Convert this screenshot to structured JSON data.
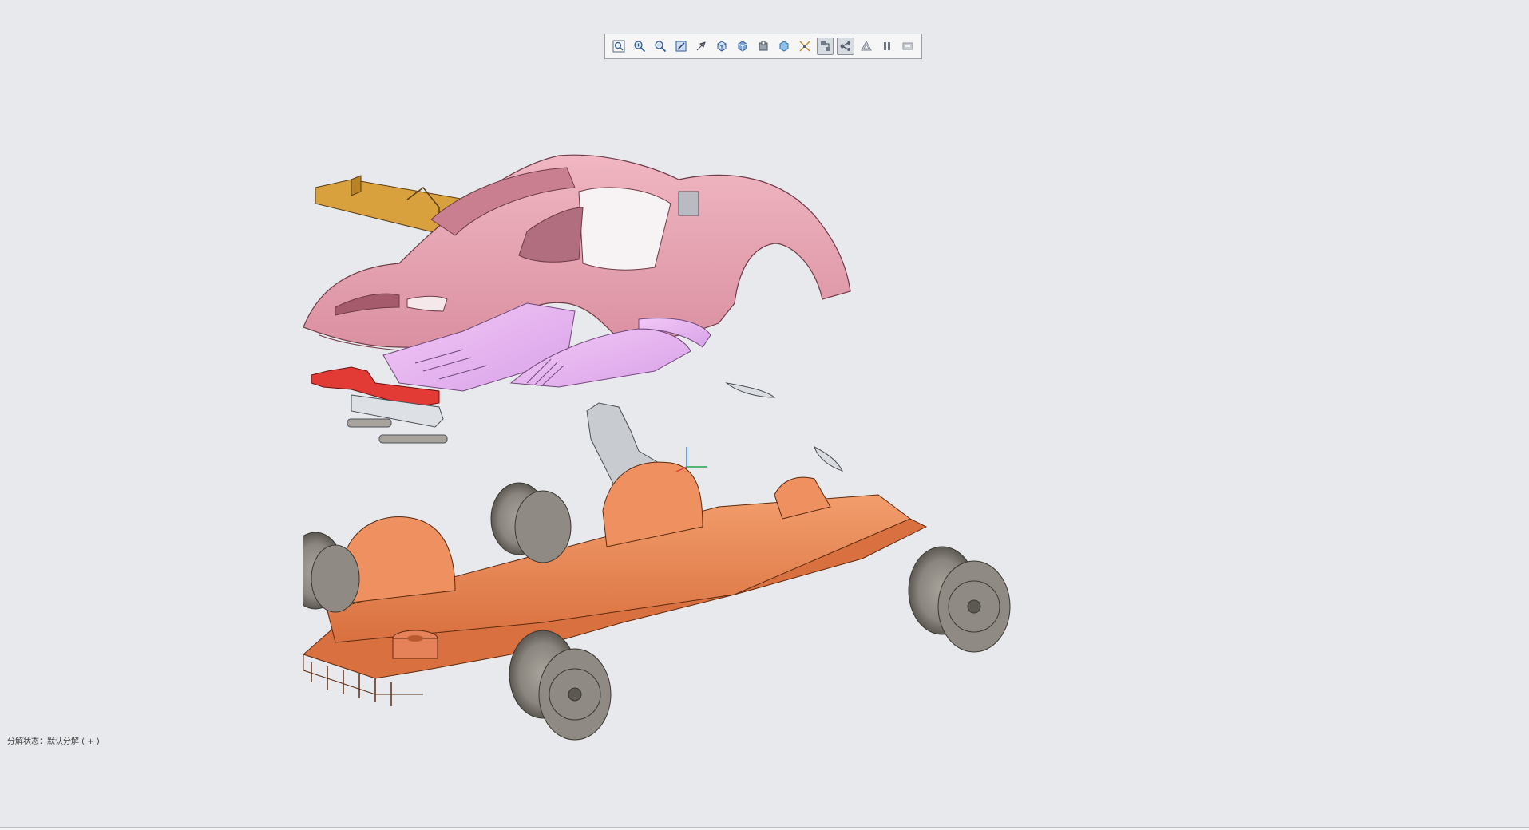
{
  "viewport": {
    "status_text": "分解状态：默认分解 ( + )"
  },
  "toolbar": {
    "buttons": [
      {
        "name": "zoom-to-fit-icon",
        "active": false
      },
      {
        "name": "zoom-in-icon",
        "active": false
      },
      {
        "name": "zoom-out-icon",
        "active": false
      },
      {
        "name": "zoom-area-icon",
        "active": false
      },
      {
        "name": "pan-icon",
        "active": false
      },
      {
        "name": "view-orientation-icon",
        "active": false
      },
      {
        "name": "display-style-icon",
        "active": false
      },
      {
        "name": "section-view-icon",
        "active": false
      },
      {
        "name": "appearance-icon",
        "active": false
      },
      {
        "name": "explode-icon",
        "active": false
      },
      {
        "name": "explode-view-icon",
        "active": true
      },
      {
        "name": "animate-icon",
        "active": true
      },
      {
        "name": "render-icon",
        "active": false
      },
      {
        "name": "pause-icon",
        "active": false
      },
      {
        "name": "end-icon",
        "active": false
      }
    ]
  },
  "colors": {
    "background": "#e8e9ec",
    "body_pink": "#e8a6b3",
    "spoiler_orange": "#d99a3a",
    "chassis_orange": "#e8865a",
    "interior_purple": "#e7b6f0",
    "seat_red": "#e23a35",
    "wheel_gray": "#8c8780"
  }
}
